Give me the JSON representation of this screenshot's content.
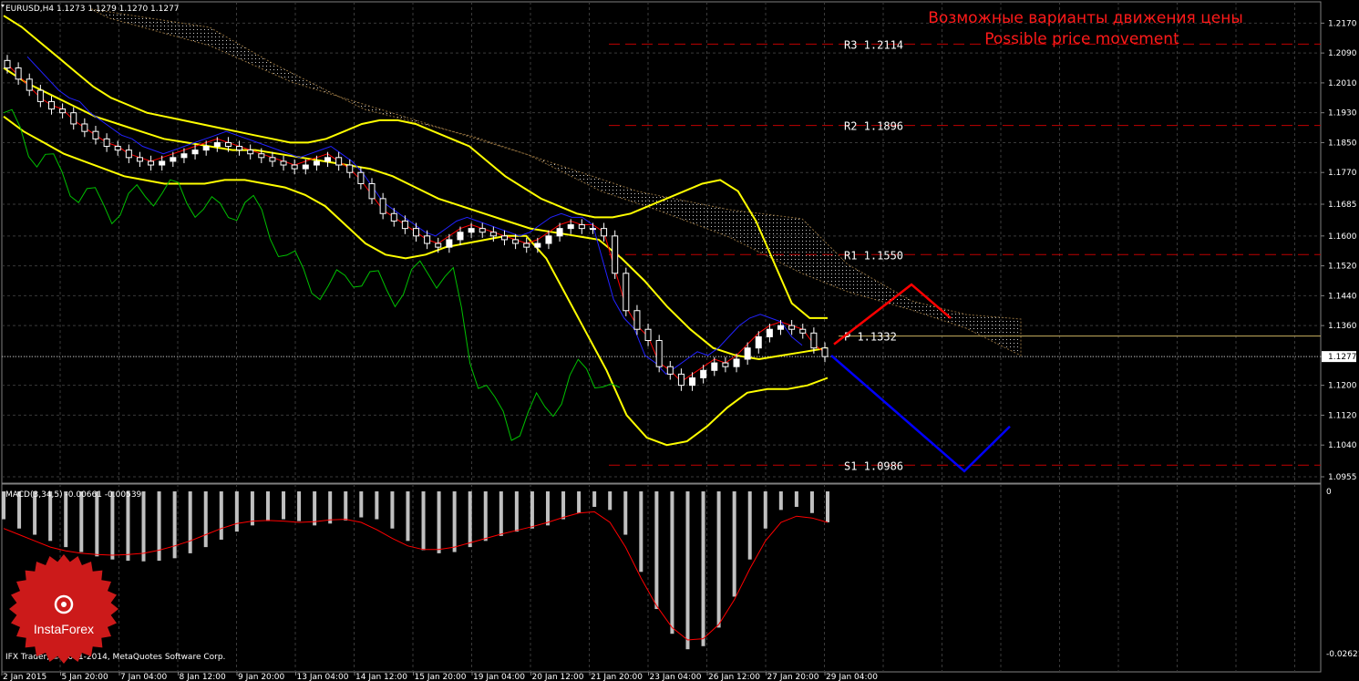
{
  "header": {
    "symbol_line": "EURUSD,H4  1.1273 1.1279 1.1270 1.1277",
    "title_ru": "Возможные варианты движения цены",
    "title_en": "Possible price movement"
  },
  "macd_label": "MACD(3,34,5) -0.00661 -0.00539",
  "footer_text": "IFX Trader, © 2001-2014, MetaQuotes Software Corp.",
  "logo": {
    "text": "InstaForex",
    "color": "#cc1a1a"
  },
  "colors": {
    "background": "#000000",
    "grid": "#3a3a3a",
    "bull_candle": "#ffffff",
    "bear_candle": "#ffffff",
    "bollinger": "#ffff00",
    "tenkan": "#ff0000",
    "kijun": "#2222ff",
    "chikou": "#00c000",
    "pivot_line": "#c8b060",
    "level_line": "#c00000",
    "forecast_up": "#ff0000",
    "forecast_down": "#0000ff",
    "macd_hist": "#c0c0c0",
    "macd_signal": "#ff0000",
    "current_price_line": "#c0c0c0"
  },
  "chart_data": [
    {
      "type": "candlestick",
      "title": "EURUSD,H4",
      "price_axis_ticks": [
        "1.2170",
        "1.2090",
        "1.2010",
        "1.1930",
        "1.1850",
        "1.1770",
        "1.1685",
        "1.1600",
        "1.1520",
        "1.1440",
        "1.1360",
        "1.1277",
        "1.1200",
        "1.1120",
        "1.1040",
        "1.0955"
      ],
      "ylim": [
        1.0955,
        1.221
      ],
      "current_price": "1.1277",
      "time_axis_labels": [
        "2 Jan 2015",
        "5 Jan 20:00",
        "7 Jan 04:00",
        "8 Jan 12:00",
        "9 Jan 20:00",
        "13 Jan 04:00",
        "14 Jan 12:00",
        "15 Jan 20:00",
        "19 Jan 04:00",
        "20 Jan 12:00",
        "21 Jan 20:00",
        "23 Jan 04:00",
        "26 Jan 12:00",
        "27 Jan 20:00",
        "29 Jan 04:00"
      ],
      "levels": [
        {
          "name": "R3",
          "label": "R3 1.2114",
          "value": 1.2114
        },
        {
          "name": "R2",
          "label": "R2 1.1896",
          "value": 1.1896
        },
        {
          "name": "R1",
          "label": "R1 1.1550",
          "value": 1.155
        },
        {
          "name": "P",
          "label": "P 1.1332",
          "value": 1.1332
        },
        {
          "name": "S1",
          "label": "S1 1.0986",
          "value": 1.0986
        }
      ],
      "close_series": [
        1.205,
        1.202,
        1.199,
        1.196,
        1.194,
        1.193,
        1.19,
        1.188,
        1.186,
        1.184,
        1.183,
        1.181,
        1.18,
        1.179,
        1.18,
        1.181,
        1.182,
        1.183,
        1.184,
        1.185,
        1.184,
        1.183,
        1.182,
        1.181,
        1.18,
        1.179,
        1.178,
        1.179,
        1.18,
        1.181,
        1.179,
        1.177,
        1.174,
        1.17,
        1.166,
        1.164,
        1.162,
        1.16,
        1.158,
        1.157,
        1.159,
        1.161,
        1.162,
        1.161,
        1.16,
        1.159,
        1.158,
        1.157,
        1.158,
        1.16,
        1.162,
        1.163,
        1.162,
        1.162,
        1.16,
        1.15,
        1.14,
        1.135,
        1.132,
        1.125,
        1.123,
        1.12,
        1.122,
        1.124,
        1.126,
        1.125,
        1.127,
        1.13,
        1.133,
        1.135,
        1.136,
        1.135,
        1.134,
        1.13,
        1.1277
      ],
      "bollinger": {
        "upper": [
          1.219,
          1.216,
          1.212,
          1.208,
          1.204,
          1.2,
          1.197,
          1.195,
          1.193,
          1.192,
          1.191,
          1.19,
          1.189,
          1.188,
          1.187,
          1.186,
          1.185,
          1.185,
          1.186,
          1.188,
          1.19,
          1.191,
          1.191,
          1.19,
          1.188,
          1.186,
          1.184,
          1.18,
          1.176,
          1.173,
          1.17,
          1.168,
          1.166,
          1.165,
          1.165,
          1.166,
          1.168,
          1.17,
          1.172,
          1.174,
          1.175,
          1.172,
          1.164,
          1.153,
          1.142,
          1.138,
          1.138
        ],
        "lower": [
          1.192,
          1.188,
          1.185,
          1.182,
          1.18,
          1.178,
          1.176,
          1.175,
          1.174,
          1.174,
          1.174,
          1.175,
          1.175,
          1.174,
          1.173,
          1.171,
          1.168,
          1.163,
          1.158,
          1.155,
          1.154,
          1.155,
          1.157,
          1.158,
          1.159,
          1.16,
          1.16,
          1.154,
          1.144,
          1.134,
          1.124,
          1.112,
          1.106,
          1.104,
          1.105,
          1.109,
          1.114,
          1.118,
          1.119,
          1.119,
          1.12,
          1.122
        ],
        "middle": [
          1.205,
          1.201,
          1.198,
          1.195,
          1.192,
          1.19,
          1.188,
          1.186,
          1.185,
          1.184,
          1.183,
          1.183,
          1.182,
          1.181,
          1.18,
          1.179,
          1.178,
          1.176,
          1.173,
          1.17,
          1.168,
          1.166,
          1.164,
          1.162,
          1.161,
          1.16,
          1.159,
          1.154,
          1.148,
          1.141,
          1.135,
          1.13,
          1.128,
          1.127,
          1.128,
          1.129,
          1.13
        ]
      },
      "forecast": {
        "up_path": [
          [
            1.131
          ],
          [
            1.147
          ],
          [
            1.138
          ]
        ],
        "down_path": [
          [
            1.128
          ],
          [
            1.097
          ],
          [
            1.109
          ]
        ]
      }
    },
    {
      "type": "bar",
      "title": "MACD(3,34,5) -0.00661 -0.00539",
      "price_axis_ticks": [
        "0",
        "-0.02621"
      ],
      "ylim": [
        -0.02621,
        0
      ],
      "hist_values": [
        -0.0045,
        -0.006,
        -0.007,
        -0.008,
        -0.009,
        -0.0098,
        -0.0105,
        -0.011,
        -0.0112,
        -0.0113,
        -0.0112,
        -0.0108,
        -0.01,
        -0.009,
        -0.0078,
        -0.0065,
        -0.0055,
        -0.0048,
        -0.0045,
        -0.0048,
        -0.0055,
        -0.0052,
        -0.0047,
        -0.0042,
        -0.0045,
        -0.006,
        -0.008,
        -0.0095,
        -0.01,
        -0.0098,
        -0.009,
        -0.008,
        -0.0072,
        -0.0065,
        -0.006,
        -0.0055,
        -0.0045,
        -0.0035,
        -0.0025,
        -0.003,
        -0.007,
        -0.013,
        -0.019,
        -0.023,
        -0.0255,
        -0.025,
        -0.022,
        -0.017,
        -0.011,
        -0.006,
        -0.003,
        -0.0025,
        -0.0035,
        -0.005
      ],
      "signal_values": [
        -0.006,
        -0.007,
        -0.008,
        -0.009,
        -0.0096,
        -0.01,
        -0.0102,
        -0.0103,
        -0.0102,
        -0.01,
        -0.0095,
        -0.0088,
        -0.008,
        -0.007,
        -0.006,
        -0.0052,
        -0.0048,
        -0.0047,
        -0.0048,
        -0.005,
        -0.0049,
        -0.0046,
        -0.0045,
        -0.005,
        -0.0062,
        -0.0076,
        -0.0088,
        -0.0094,
        -0.0094,
        -0.009,
        -0.0083,
        -0.0076,
        -0.0069,
        -0.0063,
        -0.0057,
        -0.005,
        -0.0042,
        -0.0035,
        -0.0033,
        -0.005,
        -0.009,
        -0.014,
        -0.0185,
        -0.022,
        -0.024,
        -0.0238,
        -0.0215,
        -0.0175,
        -0.0125,
        -0.008,
        -0.005,
        -0.004,
        -0.0043,
        -0.005
      ]
    }
  ]
}
